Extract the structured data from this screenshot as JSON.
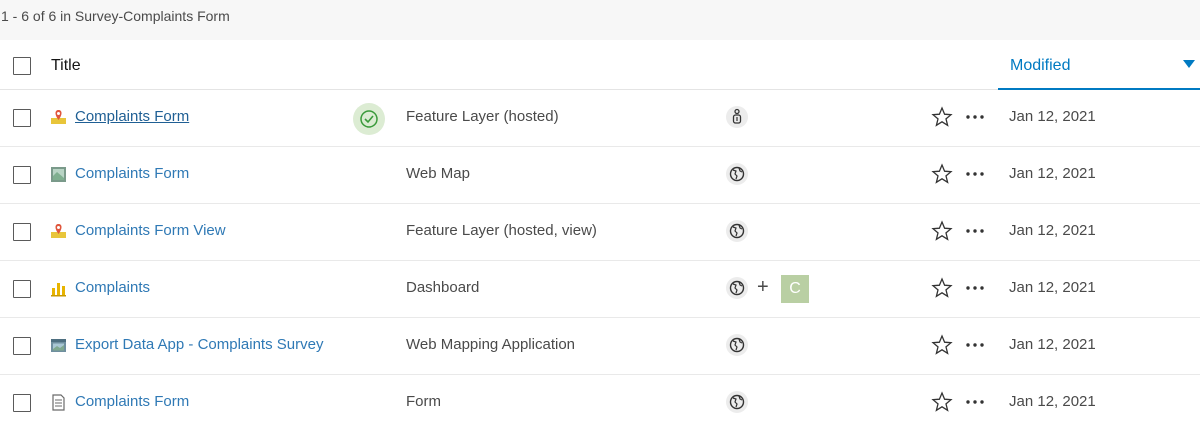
{
  "summary": "1 - 6 of 6 in Survey-Complaints Form",
  "header": {
    "title_label": "Title",
    "modified_label": "Modified"
  },
  "colors": {
    "link": "#2f79b5",
    "accent": "#007ac2",
    "ok": "#3a9a3a",
    "group_badge": "#b9cfa3"
  },
  "rows": [
    {
      "title": "Complaints Form",
      "type": "Feature Layer (hosted)",
      "icon": "feature-layer-icon",
      "share": "owner-only-icon",
      "status": "check-circle-icon",
      "date": "Jan 12, 2021"
    },
    {
      "title": "Complaints Form",
      "type": "Web Map",
      "icon": "web-map-icon",
      "share": "globe-icon",
      "date": "Jan 12, 2021"
    },
    {
      "title": "Complaints Form View",
      "type": "Feature Layer (hosted, view)",
      "icon": "feature-layer-icon",
      "share": "globe-icon",
      "date": "Jan 12, 2021"
    },
    {
      "title": "Complaints",
      "type": "Dashboard",
      "icon": "dashboard-icon",
      "share": "globe-icon",
      "group_plus": "+",
      "group_badge": "C",
      "date": "Jan 12, 2021"
    },
    {
      "title": "Export Data App - Complaints Survey",
      "type": "Web Mapping Application",
      "icon": "web-app-icon",
      "share": "globe-icon",
      "date": "Jan 12, 2021"
    },
    {
      "title": "Complaints Form",
      "type": "Form",
      "icon": "form-icon",
      "share": "globe-icon",
      "date": "Jan 12, 2021"
    }
  ]
}
